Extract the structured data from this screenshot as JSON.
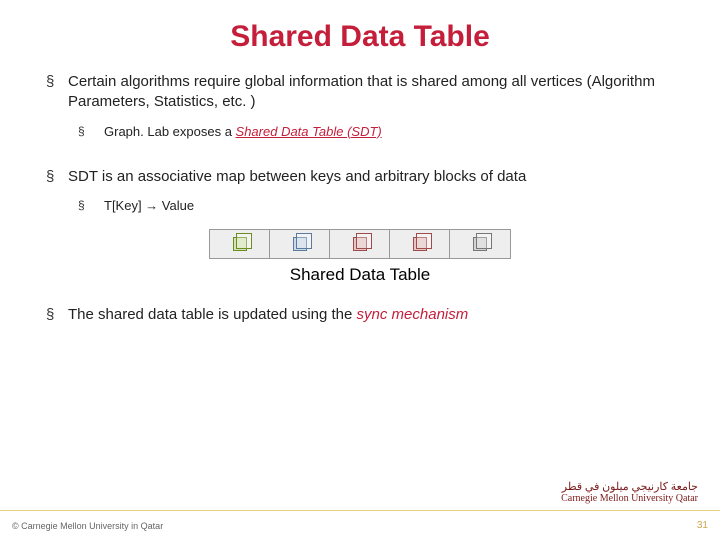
{
  "title": "Shared Data Table",
  "bullets": {
    "b1": {
      "text": "Certain algorithms require global information that is shared among all vertices (Algorithm Parameters, Statistics, etc. )",
      "sub": {
        "prefix": "Graph. Lab exposes a ",
        "emph": "Shared Data Table (SDT)"
      }
    },
    "b2": {
      "text": "SDT is an associative map between keys and arbitrary blocks of data",
      "sub": {
        "text": "T[Key] → Value"
      }
    },
    "b3": {
      "prefix": "The shared data table is updated using the ",
      "emph": "sync mechanism"
    }
  },
  "sdt_caption": "Shared Data Table",
  "footer": {
    "copyright": "© Carnegie Mellon University in Qatar",
    "page": "31"
  },
  "logo": {
    "arabic": "جامعة كارنيجي ميلون في قطر",
    "english": "Carnegie Mellon University Qatar"
  }
}
